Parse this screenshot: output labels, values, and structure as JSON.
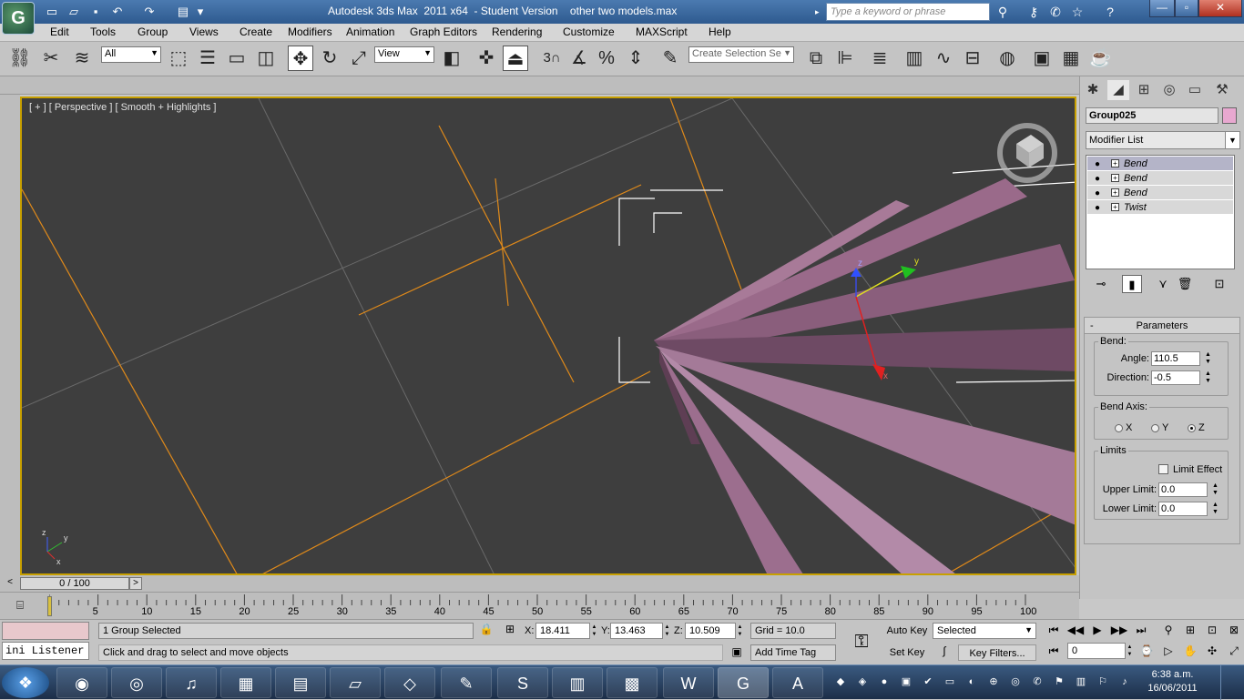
{
  "app": {
    "title": "Autodesk 3ds Max  2011 x64  - Student Version    other two models.max",
    "search_placeholder": "Type a keyword or phrase"
  },
  "menu": [
    "Edit",
    "Tools",
    "Group",
    "Views",
    "Create",
    "Modifiers",
    "Animation",
    "Graph Editors",
    "Rendering",
    "Customize",
    "MAXScript",
    "Help"
  ],
  "toolbar": {
    "filter_value": "All",
    "ref_coord_value": "View",
    "snap_label": "3",
    "selection_set_placeholder": "Create Selection Se"
  },
  "viewport": {
    "label": "[ + ] [ Perspective ] [ Smooth + Highlights ]",
    "gizmo_labels": {
      "x": "x",
      "y": "y",
      "z": "z"
    },
    "axis_labels": {
      "y": "y",
      "z": "z",
      "x": "x"
    }
  },
  "command_panel": {
    "object_name": "Group025",
    "object_color": "#e8a8d0",
    "modifier_list": "Modifier List",
    "stack": [
      "Bend",
      "Bend",
      "Bend",
      "Twist"
    ],
    "parameters_title": "Parameters",
    "bend_group": "Bend:",
    "angle_label": "Angle:",
    "angle_value": "110.5",
    "direction_label": "Direction:",
    "direction_value": "-0.5",
    "bend_axis_group": "Bend Axis:",
    "axis_x": "X",
    "axis_y": "Y",
    "axis_z": "Z",
    "limits_group": "Limits",
    "limit_effect": "Limit Effect",
    "upper_limit_label": "Upper Limit:",
    "upper_limit_value": "0.0",
    "lower_limit_label": "Lower Limit:",
    "lower_limit_value": "0.0"
  },
  "timeline": {
    "slider_text": "0 / 100",
    "prev": "<",
    "next": ">",
    "ticks": [
      "5",
      "10",
      "15",
      "20",
      "25",
      "30",
      "35",
      "40",
      "45",
      "50",
      "55",
      "60",
      "65",
      "70",
      "75",
      "80",
      "85",
      "90",
      "95",
      "100"
    ]
  },
  "status": {
    "listener": "ini Listener",
    "selection_info": "1 Group Selected",
    "prompt": "Click and drag to select and move objects",
    "x_label": "X:",
    "x_value": "18.411",
    "y_label": "Y:",
    "y_value": "13.463",
    "z_label": "Z:",
    "z_value": "10.509",
    "grid": "Grid = 10.0",
    "add_time_tag": "Add Time Tag",
    "auto_key": "Auto Key",
    "set_key": "Set Key",
    "selected": "Selected",
    "key_filters": "Key Filters...",
    "frame_value": "0"
  },
  "taskbar": {
    "time": "6:38 a.m.",
    "date": "16/06/2011"
  }
}
